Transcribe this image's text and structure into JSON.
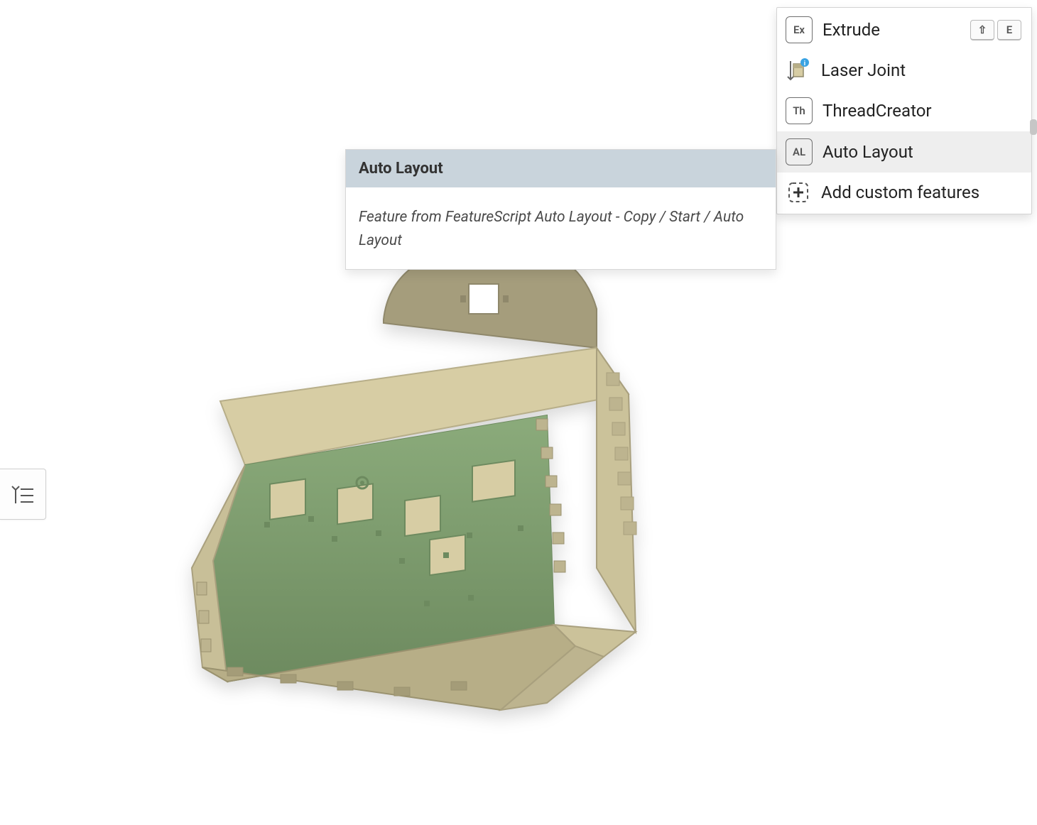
{
  "menu": {
    "items": [
      {
        "badge": "Ex",
        "label": "Extrude",
        "shortcut": [
          "⇧",
          "E"
        ],
        "type": "badge"
      },
      {
        "label": "Laser Joint",
        "type": "laser"
      },
      {
        "badge": "Th",
        "label": "ThreadCreator",
        "type": "badge"
      },
      {
        "badge": "AL",
        "label": "Auto Layout",
        "type": "badge",
        "highlighted": true
      },
      {
        "label": "Add custom features",
        "type": "plus"
      }
    ]
  },
  "tooltip": {
    "title": "Auto Layout",
    "body": "Feature from FeatureScript Auto Layout - Copy / Start / Auto Layout"
  }
}
